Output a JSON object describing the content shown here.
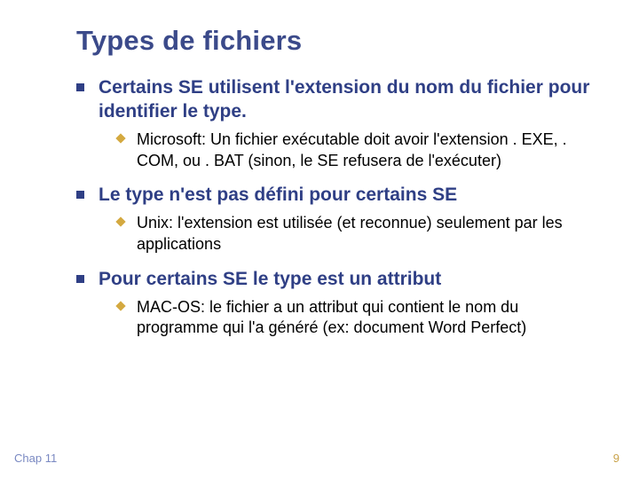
{
  "title": "Types de fichiers",
  "points": [
    {
      "text": "Certains SE utilisent l'extension du nom du fichier pour identifier le type.",
      "sub": "Microsoft: Un fichier exécutable doit avoir l'extension . EXE, . COM, ou . BAT  (sinon, le SE refusera de l'exécuter)"
    },
    {
      "text": "Le type n'est pas défini pour certains SE",
      "sub": "Unix: l'extension est utilisée (et reconnue) seulement par les applications"
    },
    {
      "text": "Pour certains SE le type est un attribut",
      "sub": "MAC-OS: le fichier a un attribut qui contient le nom du programme qui l'a généré (ex: document Word Perfect)"
    }
  ],
  "footer": {
    "left": "Chap 11",
    "right": "9"
  }
}
